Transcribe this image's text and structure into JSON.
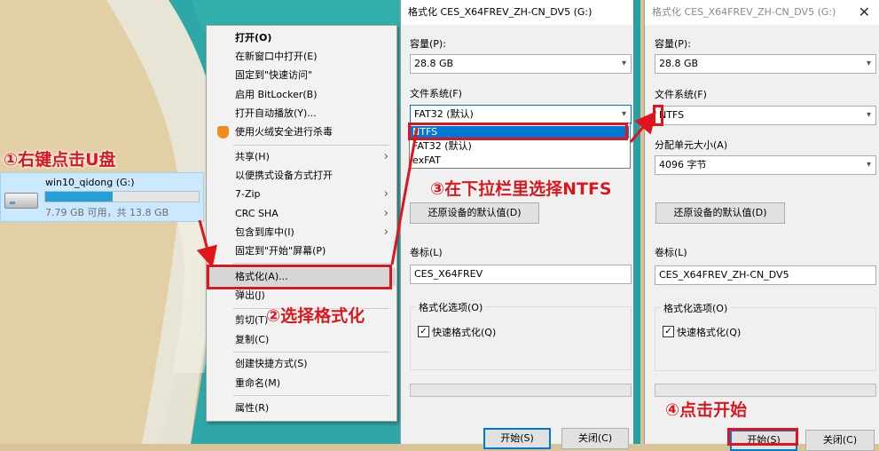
{
  "drive": {
    "name": "win10_qidong (G:)",
    "free_text": "7.79 GB 可用，共 13.8 GB",
    "used_fraction": 0.44
  },
  "menu": {
    "items": [
      {
        "label": "打开(O)"
      },
      {
        "label": "在新窗口中打开(E)"
      },
      {
        "label": "固定到\"快速访问\""
      },
      {
        "label": "启用 BitLocker(B)"
      },
      {
        "label": "打开自动播放(Y)..."
      },
      {
        "label": "使用火绒安全进行杀毒",
        "icon": "shield-icon"
      },
      {
        "label": "共享(H)"
      },
      {
        "label": "以便携式设备方式打开"
      },
      {
        "label": "7-Zip"
      },
      {
        "label": "CRC SHA"
      },
      {
        "label": "包含到库中(I)"
      },
      {
        "label": "固定到\"开始\"屏幕(P)"
      },
      {
        "label": "格式化(A)..."
      },
      {
        "label": "弹出(J)"
      },
      {
        "label": "剪切(T)"
      },
      {
        "label": "复制(C)"
      },
      {
        "label": "创建快捷方式(S)"
      },
      {
        "label": "重命名(M)"
      },
      {
        "label": "属性(R)"
      }
    ]
  },
  "dialog1": {
    "title": "格式化 CES_X64FREV_ZH-CN_DV5 (G:)",
    "capacity_label": "容量(P):",
    "capacity_value": "28.8 GB",
    "filesystem_label": "文件系统(F)",
    "filesystem_value": "FAT32 (默认)",
    "filesystem_options": [
      "NTFS",
      "FAT32 (默认)",
      "exFAT"
    ],
    "restore_button": "还原设备的默认值(D)",
    "volume_label": "卷标(L)",
    "volume_value": "CES_X64FREV",
    "options_group": "格式化选项(O)",
    "quick_format": "快速格式化(Q)",
    "start_button": "开始(S)",
    "close_button": "关闭(C)"
  },
  "dialog2": {
    "title": "格式化 CES_X64FREV_ZH-CN_DV5 (G:)",
    "capacity_label": "容量(P):",
    "capacity_value": "28.8 GB",
    "filesystem_label": "文件系统(F)",
    "filesystem_value": "NTFS",
    "alloc_label": "分配单元大小(A)",
    "alloc_value": "4096 字节",
    "restore_button": "还原设备的默认值(D)",
    "volume_label": "卷标(L)",
    "volume_value": "CES_X64FREV_ZH-CN_DV5",
    "options_group": "格式化选项(O)",
    "quick_format": "快速格式化(Q)",
    "start_button": "开始(S)",
    "close_button": "关闭(C)"
  },
  "annotations": {
    "step1": "①右键点击U盘",
    "step2": "②选择格式化",
    "step3": "③在下拉栏里选择NTFS",
    "step4": "④点击开始"
  },
  "colors": {
    "annotation_red": "#e0141b",
    "accent_blue": "#0078d7",
    "selection": "#cce8ff"
  }
}
